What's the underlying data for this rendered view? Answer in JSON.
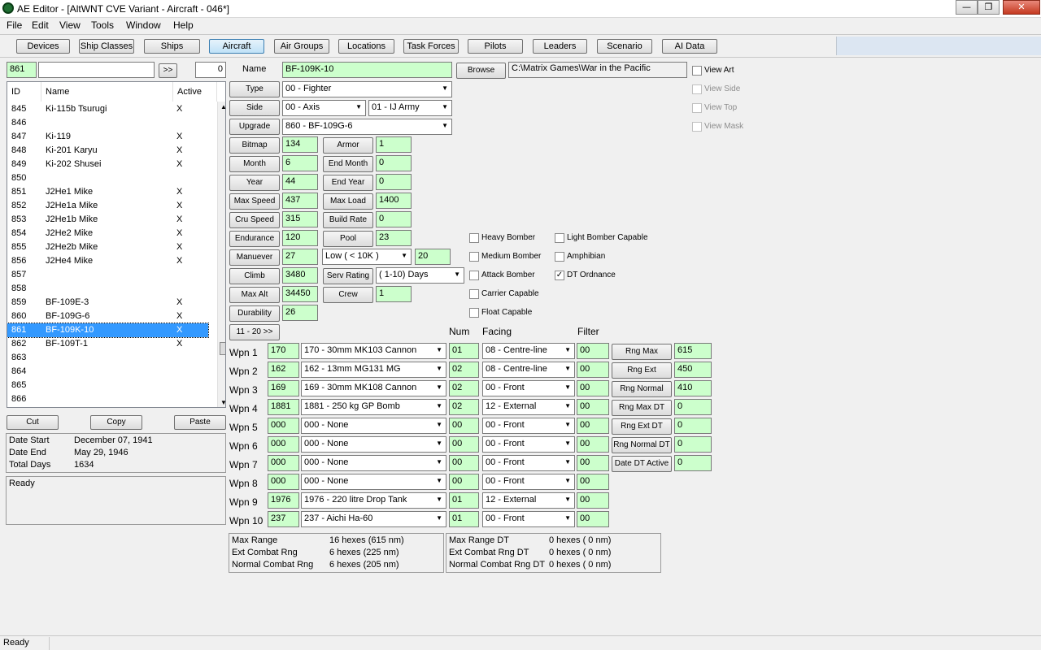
{
  "window": {
    "title": "AE Editor - [AltWNT CVE Variant - Aircraft - 046*]",
    "min": "—",
    "max": "❐",
    "close": "✕"
  },
  "menu": [
    "File",
    "Edit",
    "View",
    "Tools",
    "Window",
    "Help"
  ],
  "toolbar": [
    "Devices",
    "Ship Classes",
    "Ships",
    "Aircraft",
    "Air Groups",
    "Locations",
    "Task Forces",
    "Pilots",
    "Leaders",
    "Scenario",
    "AI Data"
  ],
  "toolbar_active": "Aircraft",
  "search": {
    "id": "861",
    "text": "",
    "go": ">>",
    "count": "0"
  },
  "list": {
    "headers": [
      "ID",
      "Name",
      "Active"
    ],
    "rows": [
      {
        "id": "845",
        "name": "Ki-115b Tsurugi",
        "active": "X"
      },
      {
        "id": "846",
        "name": "",
        "active": ""
      },
      {
        "id": "847",
        "name": "Ki-119",
        "active": "X"
      },
      {
        "id": "848",
        "name": "Ki-201 Karyu",
        "active": "X"
      },
      {
        "id": "849",
        "name": "Ki-202 Shusei",
        "active": "X"
      },
      {
        "id": "850",
        "name": "",
        "active": ""
      },
      {
        "id": "851",
        "name": "J2He1 Mike",
        "active": "X"
      },
      {
        "id": "852",
        "name": "J2He1a Mike",
        "active": "X"
      },
      {
        "id": "853",
        "name": "J2He1b Mike",
        "active": "X"
      },
      {
        "id": "854",
        "name": "J2He2 Mike",
        "active": "X"
      },
      {
        "id": "855",
        "name": "J2He2b Mike",
        "active": "X"
      },
      {
        "id": "856",
        "name": "J2He4 Mike",
        "active": "X"
      },
      {
        "id": "857",
        "name": "",
        "active": ""
      },
      {
        "id": "858",
        "name": "",
        "active": ""
      },
      {
        "id": "859",
        "name": "BF-109E-3",
        "active": "X"
      },
      {
        "id": "860",
        "name": "BF-109G-6",
        "active": "X"
      },
      {
        "id": "861",
        "name": "BF-109K-10",
        "active": "X"
      },
      {
        "id": "862",
        "name": "BF-109T-1",
        "active": "X"
      },
      {
        "id": "863",
        "name": "",
        "active": ""
      },
      {
        "id": "864",
        "name": "",
        "active": ""
      },
      {
        "id": "865",
        "name": "",
        "active": ""
      },
      {
        "id": "866",
        "name": "",
        "active": ""
      }
    ],
    "selected_id": "861"
  },
  "clip": {
    "cut": "Cut",
    "copy": "Copy",
    "paste": "Paste"
  },
  "dates": {
    "start_label": "Date Start",
    "start": "December 07, 1941",
    "end_label": "Date End",
    "end": "May 29, 1946",
    "total_label": "Total Days",
    "total": "1634"
  },
  "message": "Ready",
  "form": {
    "name_label": "Name",
    "name": "BF-109K-10",
    "browse": "Browse",
    "path": "C:\\Matrix Games\\War in the Pacific",
    "type_label": "Type",
    "type": "00 - Fighter",
    "side_label": "Side",
    "side": "00 - Axis",
    "nation": "01 - IJ Army",
    "upgrade_label": "Upgrade",
    "upgrade": "860 - BF-109G-6",
    "bitmap_label": "Bitmap",
    "bitmap": "134",
    "armor_label": "Armor",
    "armor": "1",
    "month_label": "Month",
    "month": "6",
    "end_month_label": "End Month",
    "end_month": "0",
    "year_label": "Year",
    "year": "44",
    "end_year_label": "End Year",
    "end_year": "0",
    "max_speed_label": "Max Speed",
    "max_speed": "437",
    "max_load_label": "Max Load",
    "max_load": "1400",
    "cru_speed_label": "Cru Speed",
    "cru_speed": "315",
    "build_rate_label": "Build Rate",
    "build_rate": "0",
    "endurance_label": "Endurance",
    "endurance": "120",
    "pool_label": "Pool",
    "pool": "23",
    "manuever_label": "Manuever",
    "manuever": "27",
    "alt_band": "Low   ( < 10K )",
    "alt_band_value": "20",
    "climb_label": "Climb",
    "climb": "3480",
    "serv_rating_label": "Serv Rating",
    "serv_rating": "( 1-10)  Days",
    "max_alt_label": "Max Alt",
    "max_alt": "34450",
    "crew_label": "Crew",
    "crew": "1",
    "durability_label": "Durability",
    "durability": "26",
    "next_page": "11 - 20 >>"
  },
  "view_options": [
    {
      "label": "View Art",
      "checked": false,
      "enabled": true
    },
    {
      "label": "View Side",
      "checked": false,
      "enabled": false
    },
    {
      "label": "View Top",
      "checked": false,
      "enabled": false
    },
    {
      "label": "View Mask",
      "checked": false,
      "enabled": false
    }
  ],
  "role_flags": [
    {
      "label": "Heavy Bomber",
      "checked": false
    },
    {
      "label": "Medium Bomber",
      "checked": false
    },
    {
      "label": "Attack Bomber",
      "checked": false
    },
    {
      "label": "Carrier Capable",
      "checked": false
    },
    {
      "label": "Float Capable",
      "checked": false
    }
  ],
  "role_flags2": [
    {
      "label": "Light Bomber Capable",
      "checked": false
    },
    {
      "label": "Amphibian",
      "checked": false
    },
    {
      "label": "DT Ordnance",
      "checked": true
    }
  ],
  "weapons_headers": {
    "num": "Num",
    "facing": "Facing",
    "filter": "Filter"
  },
  "weapons": [
    {
      "label": "Wpn 1",
      "id": "170",
      "name": "170 - 30mm MK103 Cannon",
      "num": "01",
      "facing": "08 - Centre-line",
      "filter": "00"
    },
    {
      "label": "Wpn 2",
      "id": "162",
      "name": "162 - 13mm MG131 MG",
      "num": "02",
      "facing": "08 - Centre-line",
      "filter": "00"
    },
    {
      "label": "Wpn 3",
      "id": "169",
      "name": "169 - 30mm MK108 Cannon",
      "num": "02",
      "facing": "00 - Front",
      "filter": "00"
    },
    {
      "label": "Wpn 4",
      "id": "1881",
      "name": "1881 - 250 kg GP Bomb",
      "num": "02",
      "facing": "12 - External",
      "filter": "00"
    },
    {
      "label": "Wpn 5",
      "id": "000",
      "name": "000 - None",
      "num": "00",
      "facing": "00 - Front",
      "filter": "00"
    },
    {
      "label": "Wpn 6",
      "id": "000",
      "name": "000 - None",
      "num": "00",
      "facing": "00 - Front",
      "filter": "00"
    },
    {
      "label": "Wpn 7",
      "id": "000",
      "name": "000 - None",
      "num": "00",
      "facing": "00 - Front",
      "filter": "00"
    },
    {
      "label": "Wpn 8",
      "id": "000",
      "name": "000 - None",
      "num": "00",
      "facing": "00 - Front",
      "filter": "00"
    },
    {
      "label": "Wpn 9",
      "id": "1976",
      "name": "1976 - 220 litre Drop Tank",
      "num": "01",
      "facing": "12 - External",
      "filter": "00"
    },
    {
      "label": "Wpn 10",
      "id": "237",
      "name": "237 - Aichi Ha-60",
      "num": "01",
      "facing": "00 - Front",
      "filter": "00"
    }
  ],
  "ranges": [
    {
      "label": "Rng Max",
      "value": "615"
    },
    {
      "label": "Rng Ext",
      "value": "450"
    },
    {
      "label": "Rng Normal",
      "value": "410"
    },
    {
      "label": "Rng Max DT",
      "value": "0"
    },
    {
      "label": "Rng Ext DT",
      "value": "0"
    },
    {
      "label": "Rng Normal DT",
      "value": "0"
    },
    {
      "label": "Date DT Active",
      "value": "0"
    }
  ],
  "summary_left": [
    {
      "label": "Max Range",
      "value": "16 hexes (615 nm)"
    },
    {
      "label": "Ext Combat Rng",
      "value": "6 hexes (225 nm)"
    },
    {
      "label": "Normal Combat Rng",
      "value": "6 hexes (205 nm)"
    }
  ],
  "summary_right": [
    {
      "label": "Max Range DT",
      "value": "0 hexes ( 0 nm)"
    },
    {
      "label": "Ext Combat Rng DT",
      "value": "0 hexes ( 0 nm)"
    },
    {
      "label": "Normal Combat Rng DT",
      "value": "0 hexes ( 0 nm)"
    }
  ],
  "status": "Ready",
  "colors": {
    "field_green": "#ccffcc",
    "selection": "#3399ff"
  }
}
